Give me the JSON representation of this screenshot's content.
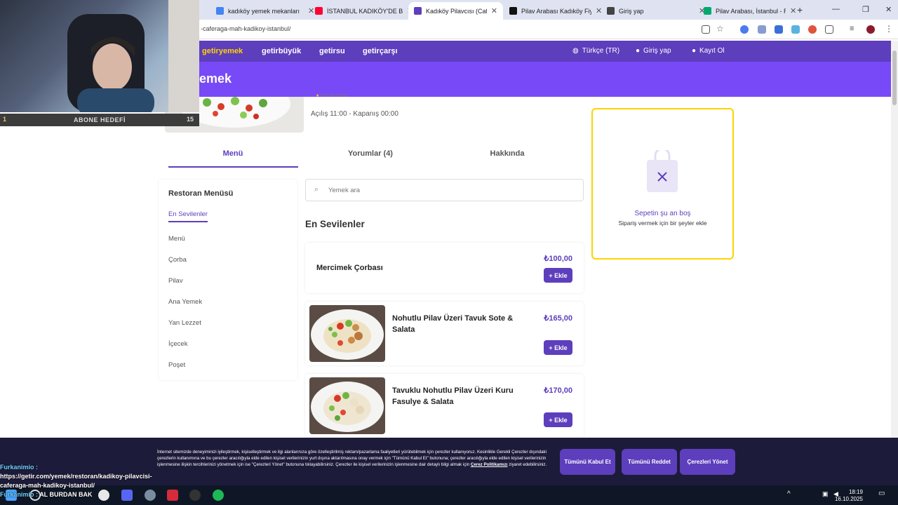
{
  "browser": {
    "tabs": [
      {
        "label": "kadıköy yemek mekanları",
        "favicon_color": "#4285f4"
      },
      {
        "label": "İSTANBUL KADIKÖY'DE Bİ",
        "favicon_color": "#ff0033"
      },
      {
        "label": "Kadıköy Pilavcısı (Caferağ",
        "favicon_color": "#5d3ebc",
        "active": true
      },
      {
        "label": "Pilav Arabası Kadıköy Fiya",
        "favicon_color": "#111111"
      },
      {
        "label": "Giriş yap",
        "favicon_color": "#444444"
      },
      {
        "label": "Pilav Arabası, İstanbul - R",
        "favicon_color": "#00aa6c"
      }
    ],
    "url": "-caferaga-mah-kadikoy-istanbul/"
  },
  "nav": {
    "brand": "getiryemek",
    "links": [
      "getirbüyük",
      "getirsu",
      "getirçarşı"
    ],
    "language": "Türkçe (TR)",
    "login": "Giriş yap",
    "signup": "Kayıt Ol",
    "band_title": "emek"
  },
  "restaurant": {
    "badge": "Hızlı Restoran",
    "hours": "Açılış 11:00 - Kapanış 00:00"
  },
  "tabs": [
    "Menü",
    "Yorumlar (4)",
    "Hakkında"
  ],
  "menu": {
    "title": "Restoran Menüsü",
    "categories": [
      "En Sevilenler",
      "Menü",
      "Çorba",
      "Pilav",
      "Ana Yemek",
      "Yan Lezzet",
      "İçecek",
      "Poşet"
    ]
  },
  "search": {
    "placeholder": "Yemek ara"
  },
  "section_title": "En Sevilenler",
  "products": [
    {
      "name": "Mercimek Çorbası",
      "price": "₺100,00",
      "add": "+ Ekle"
    },
    {
      "name": "Nohutlu Pilav Üzeri Tavuk Sote & Salata",
      "price": "₺165,00",
      "add": "+ Ekle"
    },
    {
      "name": "Tavuklu Nohutlu Pilav Üzeri Kuru Fasulye & Salata",
      "price": "₺170,00",
      "add": "+ Ekle"
    }
  ],
  "basket": {
    "title": "Sepetin şu an boş",
    "subtitle": "Sipariş vermek için bir şeyler ekle"
  },
  "cookie": {
    "text": "İnternet sitemizde deneyiminizi iyileştirmek, kişiselleştirmek ve ilgi alanlarınıza göre özelleştirilmiş reklam/pazarlama faaliyetleri yürütebilmek için çerezler kullanıyoruz. Kesinlikle Gerekli Çerezler dışındaki çerezlerin kullanımına ve bu çerezler aracılığıyla elde edilen kişisel verilerinizin yurt dışına aktarılmasına onay vermek için \"Tümünü Kabul Et\" butonuna; çerezler aracılığıyla elde edilen kişisel verilerinizin işlenmesine ilişkin tercihlerinizi yönetmek için ise \"Çerezleri Yönet\" butonuna tıklayabilirsiniz. Çerezler ile kişisel verilerinizin işlenmesine dair detaylı bilgi almak için",
    "link": "Çerez Politikamızı",
    "suffix": "ziyaret edebilirsiniz.",
    "accept": "Tümünü Kabul Et",
    "reject": "Tümünü Reddet",
    "manage": "Çerezleri Yönet"
  },
  "overlay": {
    "sub_left": "1",
    "sub_title": "ABONE HEDEFİ",
    "sub_right": "15",
    "chat_user": "Furkanimio :",
    "chat_msg": "https://getir.com/yemek/restoran/kadikoy-pilavcisi-caferaga-mah-kadikoy-istanbul/",
    "chat_user2": "Furkanimio :",
    "chat_msg2": "AL BURDAN BAK"
  },
  "taskbar": {
    "time": "18:19",
    "date": "16.10.2025"
  },
  "colors": {
    "brand": "#5d3ebc",
    "brand_light": "#7849f7",
    "basket_border": "#ffd300"
  }
}
